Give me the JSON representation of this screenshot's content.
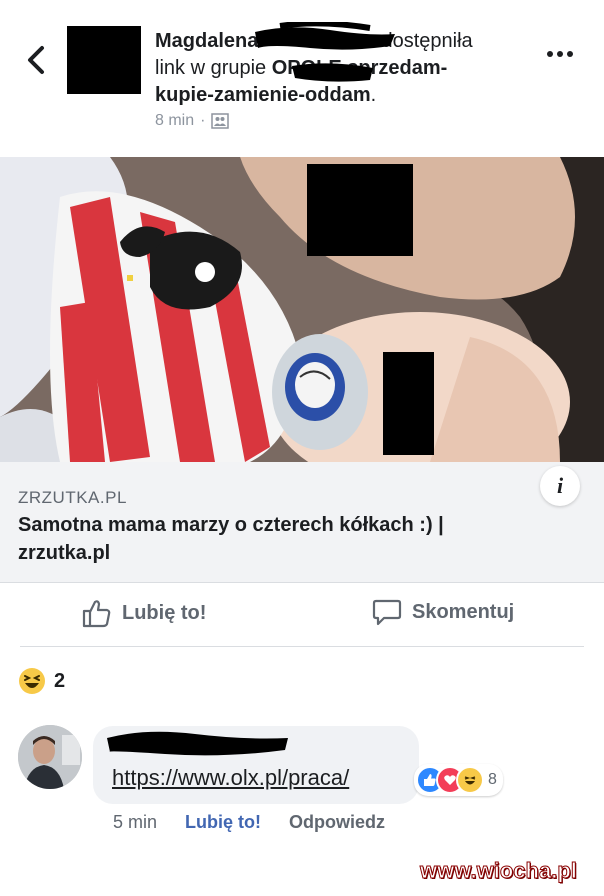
{
  "header": {
    "author": "Magdalena",
    "shared_text": "udostępniła",
    "line2_prefix": "link w grupie ",
    "group_name_line1": "OPOLE sprzedam-",
    "group_name_line2": "kupie-zamienie-oddam",
    "group_name_end": ".",
    "time": "8 min",
    "privacy_icon": "group-icon",
    "more_icon": "more-dots-icon",
    "back_icon": "back-chevron-icon"
  },
  "link_preview": {
    "domain": "ZRZUTKA.PL",
    "title": "Samotna mama marzy o czterech kółkach :) | zrzutka.pl",
    "info_icon": "i"
  },
  "actions": {
    "like_label": "Lubię to!",
    "comment_label": "Skomentuj"
  },
  "reactions": {
    "emoji": "haha-icon",
    "count": "2"
  },
  "comment": {
    "link_text": "https://www.olx.pl/praca/",
    "reaction_icons": [
      "like-icon",
      "love-icon",
      "haha-icon"
    ],
    "reaction_count": "8",
    "time": "5 min",
    "like_label": "Lubię to!",
    "reply_label": "Odpowiedz"
  },
  "watermark": "www.wiocha.pl",
  "colors": {
    "link_blue": "#4267b2",
    "gray_text": "#606770",
    "redaction": "#000000"
  }
}
